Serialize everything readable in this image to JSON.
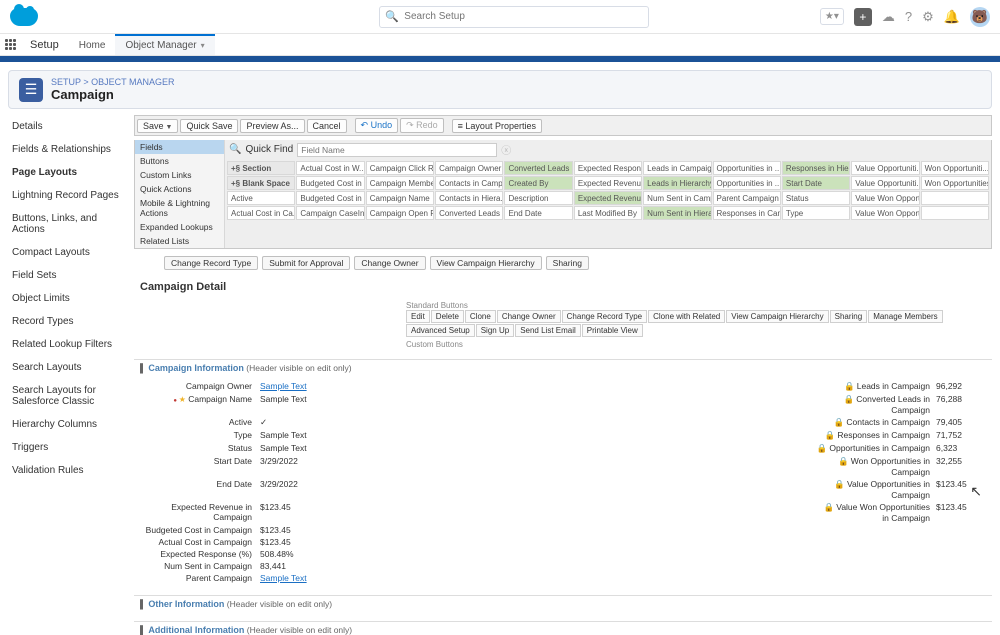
{
  "global": {
    "search_placeholder": "Search Setup",
    "nav_app": "Setup",
    "nav_tabs": [
      {
        "label": "Home"
      },
      {
        "label": "Object Manager",
        "active": true
      }
    ]
  },
  "breadcrumb": {
    "a": "SETUP",
    "b": "OBJECT MANAGER"
  },
  "object_title": "Campaign",
  "sidebar": {
    "items": [
      "Details",
      "Fields & Relationships",
      "Page Layouts",
      "Lightning Record Pages",
      "Buttons, Links, and Actions",
      "Compact Layouts",
      "Field Sets",
      "Object Limits",
      "Record Types",
      "Related Lookup Filters",
      "Search Layouts",
      "Search Layouts for Salesforce Classic",
      "Hierarchy Columns",
      "Triggers",
      "Validation Rules"
    ],
    "selected": 2
  },
  "toolbar": {
    "save": "Save",
    "quick_save": "Quick Save",
    "preview_as": "Preview As...",
    "cancel": "Cancel",
    "undo": "Undo",
    "redo": "Redo",
    "layout_props": "Layout Properties"
  },
  "palette": {
    "quick_find_label": "Quick Find",
    "quick_find_placeholder": "Field Name",
    "categories": [
      "Fields",
      "Buttons",
      "Custom Links",
      "Quick Actions",
      "Mobile & Lightning Actions",
      "Expanded Lookups",
      "Related Lists"
    ],
    "selected_cat": 0,
    "grid": [
      [
        "+§ Section",
        "Actual Cost in W...",
        "Campaign Click Rate",
        "Campaign Owner",
        "Converted Leads i...",
        "Expected Response...",
        "Leads in Campaign",
        "Opportunities in ...",
        "Responses in Hier...",
        "Value Opportuniti...",
        "Won Opportuniti..."
      ],
      [
        "+§ Blank Space",
        "Budgeted Cost in ...",
        "Campaign Member Type",
        "Contacts in Campa...",
        "Created By",
        "Expected Revenue",
        "Leads in Hierarchy",
        "Opportunities in ...",
        "Start Date",
        "Value Opportuniti...",
        "Won Opportunities..."
      ],
      [
        "Active",
        "Budgeted Cost in ...",
        "Campaign Name",
        "Contacts in Hiera...",
        "Description",
        "Expected Revenue ...",
        "Num Sent in Campaign",
        "Parent Campaign",
        "Status",
        "Value Won Opportu...",
        ""
      ],
      [
        "Actual Cost in Ca...",
        "Campaign CaseInsId",
        "Campaign Open Rate",
        "Converted Leads i...",
        "End Date",
        "Last Modified By",
        "Num Sent in Hiera...",
        "Responses in Cam...",
        "Type",
        "Value Won Opportu...",
        ""
      ]
    ]
  },
  "std_actions": [
    "Change Record Type",
    "Submit for Approval",
    "Change Owner",
    "View Campaign Hierarchy",
    "Sharing"
  ],
  "detail": {
    "heading": "Campaign Detail",
    "std_label": "Standard Buttons",
    "cust_label": "Custom Buttons",
    "buttons": [
      "Edit",
      "Delete",
      "Clone",
      "Change Owner",
      "Change Record Type",
      "Clone with Related",
      "View Campaign Hierarchy",
      "Sharing",
      "Manage Members",
      "Advanced Setup",
      "Sign Up",
      "Send List Email",
      "Printable View"
    ]
  },
  "sections": {
    "info_title": "Campaign Information",
    "note": "(Header visible on edit only)",
    "other_title": "Other Information",
    "addl_title": "Additional Information"
  },
  "left_fields": [
    {
      "label": "Campaign Owner",
      "value": "Sample Text",
      "link": true
    },
    {
      "label": "Campaign Name",
      "value": "Sample Text",
      "req": true,
      "star": true
    },
    {
      "label": "Active",
      "value": "✓"
    },
    {
      "label": "Type",
      "value": "Sample Text"
    },
    {
      "label": "Status",
      "value": "Sample Text"
    },
    {
      "label": "Start Date",
      "value": "3/29/2022"
    },
    {
      "label": "End Date",
      "value": "3/29/2022"
    },
    {
      "label": "Expected Revenue in Campaign",
      "value": "$123.45"
    },
    {
      "label": "Budgeted Cost in Campaign",
      "value": "$123.45"
    },
    {
      "label": "Actual Cost in Campaign",
      "value": "$123.45"
    },
    {
      "label": "Expected Response (%)",
      "value": "508.48%"
    },
    {
      "label": "Num Sent in Campaign",
      "value": "83,441"
    },
    {
      "label": "Parent Campaign",
      "value": "Sample Text",
      "link": true
    }
  ],
  "right_fields": [
    {
      "label": "Leads in Campaign",
      "value": "96,292"
    },
    {
      "label": "Converted Leads in Campaign",
      "value": "76,288"
    },
    {
      "label": "Contacts in Campaign",
      "value": "79,405"
    },
    {
      "label": "Responses in Campaign",
      "value": "71,752"
    },
    {
      "label": "Opportunities in Campaign",
      "value": "6,323"
    },
    {
      "label": "Won Opportunities in Campaign",
      "value": "32,255"
    },
    {
      "label": "Value Opportunities in Campaign",
      "value": "$123.45"
    },
    {
      "label": "Value Won Opportunities in Campaign",
      "value": "$123.45"
    }
  ]
}
